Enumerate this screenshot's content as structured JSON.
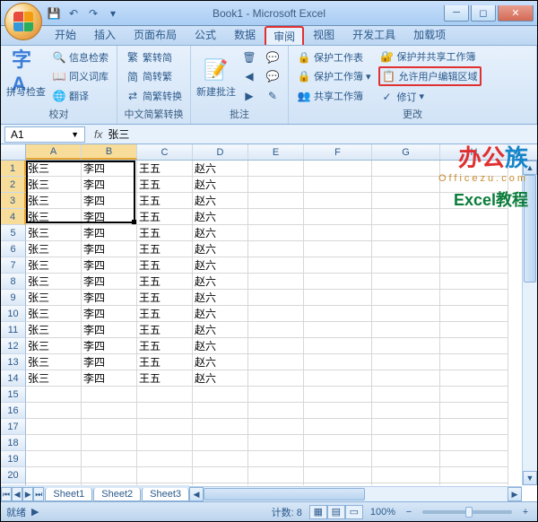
{
  "window": {
    "title": "Book1 - Microsoft Excel"
  },
  "tabs": [
    "开始",
    "插入",
    "页面布局",
    "公式",
    "数据",
    "审阅",
    "视图",
    "开发工具",
    "加载项"
  ],
  "active_tab": "审阅",
  "ribbon": {
    "proofing": {
      "label": "校对",
      "spell": "拼写检查",
      "research": "信息检索",
      "thesaurus": "同义词库",
      "translate": "翻译"
    },
    "chinese": {
      "label": "中文简繁转换",
      "t2s": "繁转简",
      "s2t": "简转繁",
      "convert": "简繁转换"
    },
    "comments": {
      "label": "批注",
      "new": "新建批注"
    },
    "changes": {
      "label": "更改",
      "protect_sheet": "保护工作表",
      "protect_book": "保护工作簿",
      "share_book": "共享工作簿",
      "protect_share": "保护并共享工作簿",
      "allow_edit": "允许用户编辑区域",
      "track": "修订"
    }
  },
  "namebox": "A1",
  "formula": "张三",
  "columns": [
    "A",
    "B",
    "C",
    "D",
    "E",
    "F",
    "G",
    "H"
  ],
  "selected_cols": [
    "A",
    "B"
  ],
  "selected_rows": [
    1,
    2,
    3,
    4
  ],
  "selection_count_label": "计数: 8",
  "chart_data": {
    "type": "table",
    "columns": [
      "A",
      "B",
      "C",
      "D"
    ],
    "rows": [
      [
        "张三",
        "李四",
        "王五",
        "赵六"
      ],
      [
        "张三",
        "李四",
        "王五",
        "赵六"
      ],
      [
        "张三",
        "李四",
        "王五",
        "赵六"
      ],
      [
        "张三",
        "李四",
        "王五",
        "赵六"
      ],
      [
        "张三",
        "李四",
        "王五",
        "赵六"
      ],
      [
        "张三",
        "李四",
        "王五",
        "赵六"
      ],
      [
        "张三",
        "李四",
        "王五",
        "赵六"
      ],
      [
        "张三",
        "李四",
        "王五",
        "赵六"
      ],
      [
        "张三",
        "李四",
        "王五",
        "赵六"
      ],
      [
        "张三",
        "李四",
        "王五",
        "赵六"
      ],
      [
        "张三",
        "李四",
        "王五",
        "赵六"
      ],
      [
        "张三",
        "李四",
        "王五",
        "赵六"
      ],
      [
        "张三",
        "李四",
        "王五",
        "赵六"
      ],
      [
        "张三",
        "李四",
        "王五",
        "赵六"
      ]
    ]
  },
  "total_rows_shown": 21,
  "sheets": [
    "Sheet1",
    "Sheet2",
    "Sheet3"
  ],
  "active_sheet": "Sheet1",
  "status": {
    "ready": "就绪",
    "zoom": "100%"
  },
  "watermark": {
    "line1": "办公族",
    "line2": "Officezu.com",
    "line3": "Excel教程"
  }
}
